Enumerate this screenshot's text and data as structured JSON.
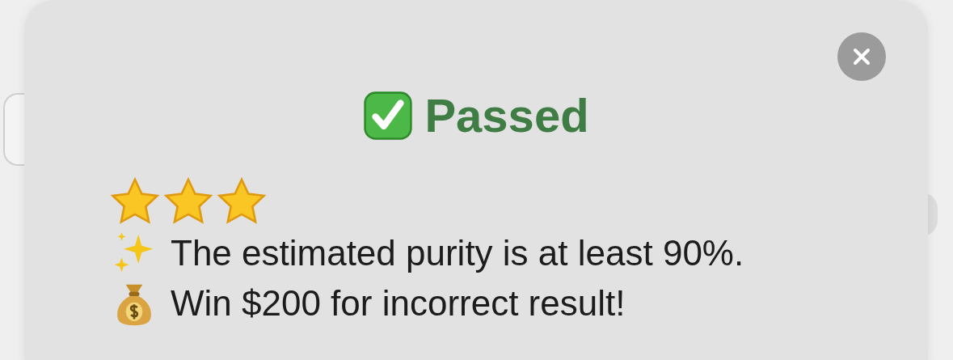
{
  "dialog": {
    "title": "Passed",
    "stars": 3,
    "lines": [
      {
        "kind": "sparkles",
        "text": "The estimated purity is at least 90%."
      },
      {
        "kind": "money",
        "text": "Win $200 for incorrect result!"
      }
    ]
  }
}
